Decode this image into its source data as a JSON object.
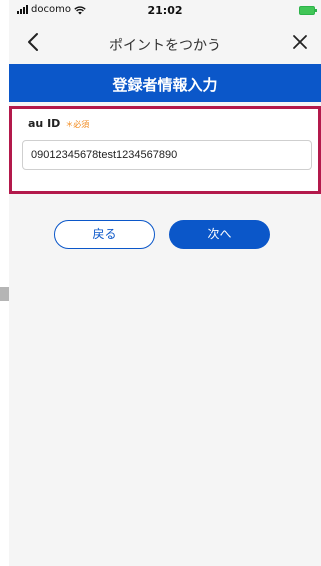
{
  "status_bar": {
    "carrier": "docomo",
    "time": "21:02",
    "signal_icon": "signal-bars-icon",
    "wifi_icon": "wifi-icon",
    "battery_icon": "battery-charging-icon"
  },
  "nav": {
    "title": "ポイントをつかう",
    "back_icon": "chevron-left-icon",
    "close_icon": "close-icon"
  },
  "header": {
    "title": "登録者情報入力"
  },
  "form": {
    "label": "au ID",
    "required": "＊必須",
    "value": "09012345678test1234567890"
  },
  "buttons": {
    "back": "戻る",
    "next": "次へ"
  },
  "colors": {
    "primary": "#0b57c9",
    "highlight": "#b3194b",
    "required": "#f28a1c"
  }
}
